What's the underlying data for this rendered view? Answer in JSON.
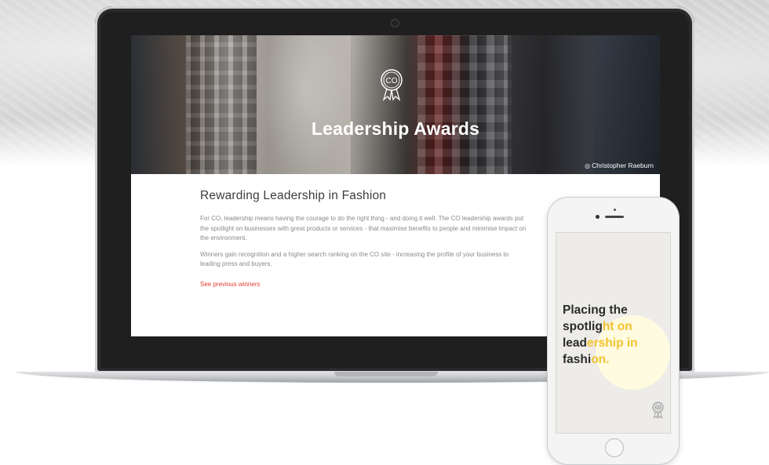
{
  "hero": {
    "logo_text": "CO",
    "title": "Leadership Awards",
    "photo_credit": "Christopher Raeburn"
  },
  "content": {
    "heading": "Rewarding Leadership in Fashion",
    "paragraph_1": "For CO, leadership means having the courage to do the right thing - and doing it well. The CO leadership awards put the spotlight on businesses with great products or services - that maximise benefits to people and minimise impact on the environment.",
    "paragraph_2": "Winners gain recognition and a higher search ranking on the CO site - increasing the profile of your business to leading press and buyers.",
    "link_label": "See previous winners"
  },
  "phone": {
    "line_1_dark": "Placing the",
    "line_2_dark": "spotlig",
    "line_2_yellow": "ht on",
    "line_3_dark": "lead",
    "line_3_yellow": "ership in",
    "line_4_dark": "fashi",
    "line_4_yellow": "on.",
    "logo_text": "CO"
  },
  "colors": {
    "link_red": "#e23b2e",
    "accent_yellow": "#f2c230",
    "heading_dark": "#3d3d3d"
  }
}
